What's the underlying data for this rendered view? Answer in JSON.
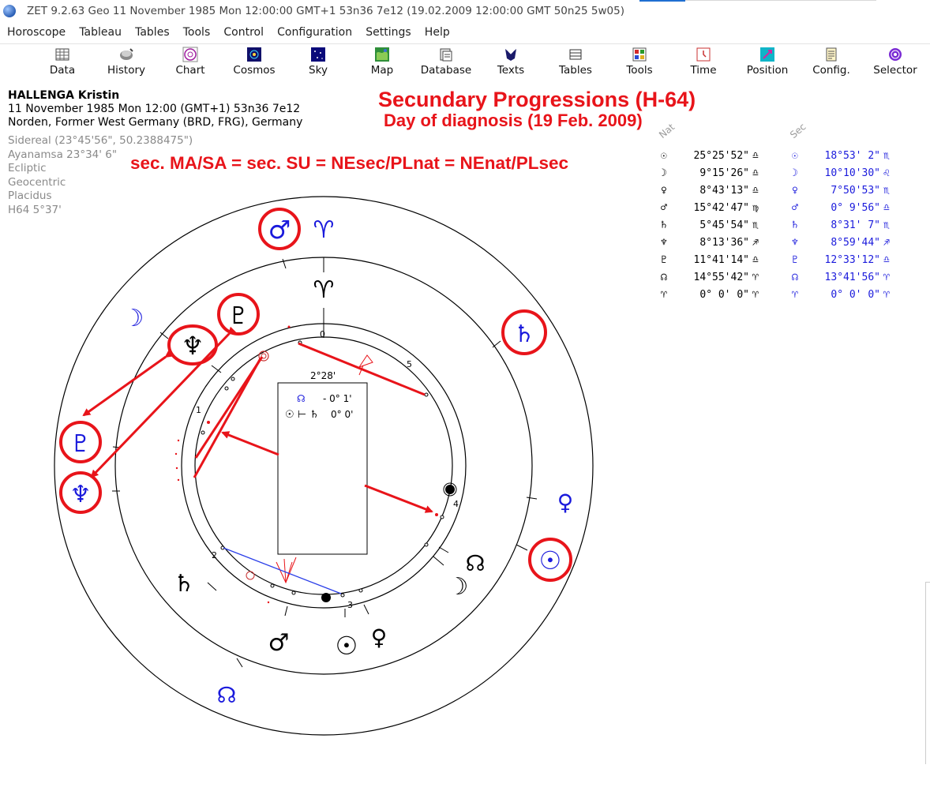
{
  "window": {
    "title": "ZET 9.2.63 Geo    11 November 1985  Mon  12:00:00 GMT+1 53n36  7e12  (19.02.2009  12:00:00 GMT 50n25 5w05)"
  },
  "menu": [
    "Horoscope",
    "Tableau",
    "Tables",
    "Tools",
    "Control",
    "Configuration",
    "Settings",
    "Help"
  ],
  "toolbar": [
    {
      "label": "Data",
      "icon": "data-icon"
    },
    {
      "label": "History",
      "icon": "history-icon"
    },
    {
      "label": "Chart",
      "icon": "chart-icon"
    },
    {
      "label": "Cosmos",
      "icon": "cosmos-icon"
    },
    {
      "label": "Sky",
      "icon": "sky-icon"
    },
    {
      "label": "Map",
      "icon": "map-icon"
    },
    {
      "label": "Database",
      "icon": "database-icon"
    },
    {
      "label": "Texts",
      "icon": "texts-icon"
    },
    {
      "label": "Tables",
      "icon": "tables-icon"
    },
    {
      "label": "Tools",
      "icon": "tools-icon"
    },
    {
      "label": "Time",
      "icon": "time-icon"
    },
    {
      "label": "Position",
      "icon": "position-icon"
    },
    {
      "label": "Config.",
      "icon": "config-icon"
    },
    {
      "label": "Selector",
      "icon": "selector-icon"
    }
  ],
  "info": {
    "name": "HALLENGA Kristin",
    "datetime": "11 November 1985  Mon  12:00 (GMT+1) 53n36  7e12",
    "place": "Norden, Former West Germany (BRD, FRG), Germany",
    "settings": [
      "Sidereal (23°45'56\", 50.2388475\")",
      "Ayanamsa 23°34' 6\"",
      "Ecliptic",
      "Geocentric",
      "Placidus",
      "H64   5°37'"
    ]
  },
  "annotations": {
    "title": "Secundary Progressions (H-64)",
    "subtitle": "Day of diagnosis (19 Feb. 2009)",
    "formula": "sec. MA/SA = sec. SU = NEsec/PLnat = NEnat/PLsec"
  },
  "table": {
    "header_nat": "Nat",
    "header_sec": "Sec",
    "rows": [
      {
        "glyph": "☉",
        "nat": "25°25'52\"",
        "nat_sign": "♎",
        "sec": "18°53' 2\"",
        "sec_sign": "♏"
      },
      {
        "glyph": "☽",
        "nat": "9°15'26\"",
        "nat_sign": "♎",
        "sec": "10°10'30\"",
        "sec_sign": "♌"
      },
      {
        "glyph": "♀",
        "nat": "8°43'13\"",
        "nat_sign": "♎",
        "sec": "7°50'53\"",
        "sec_sign": "♏"
      },
      {
        "glyph": "♂",
        "nat": "15°42'47\"",
        "nat_sign": "♍",
        "sec": "0° 9'56\"",
        "sec_sign": "♎"
      },
      {
        "glyph": "♄",
        "nat": "5°45'54\"",
        "nat_sign": "♏",
        "sec": "8°31' 7\"",
        "sec_sign": "♏"
      },
      {
        "glyph": "♆",
        "nat": "8°13'36\"",
        "nat_sign": "♐",
        "sec": "8°59'44\"",
        "sec_sign": "♐"
      },
      {
        "glyph": "♇",
        "nat": "11°41'14\"",
        "nat_sign": "♎",
        "sec": "12°33'12\"",
        "sec_sign": "♎"
      },
      {
        "glyph": "☊",
        "nat": "14°55'42\"",
        "nat_sign": "♈",
        "sec": "13°41'56\"",
        "sec_sign": "♈"
      },
      {
        "glyph": "♈",
        "nat": "0° 0' 0\"",
        "nat_sign": "♈",
        "sec": "0° 0' 0\"",
        "sec_sign": "♈"
      }
    ]
  },
  "chart": {
    "sec_glyphs": {
      "mars": "♂",
      "aries": "♈",
      "moon": "☽",
      "neptune": "♆",
      "pluto": "♇",
      "saturn": "♄",
      "venus": "♀",
      "sun": "☉",
      "node": "☊"
    },
    "nat_glyphs": {
      "aries": "♈",
      "pluto": "♇",
      "saturn": "♄",
      "mars": "♂",
      "sun": "☉",
      "venus": "♀",
      "moon": "☽",
      "node": "☊"
    },
    "house_numbers": [
      "0",
      "1",
      "2",
      "3",
      "4",
      "5"
    ],
    "box": {
      "arc": "2°28'",
      "node_row": "☊",
      "node_val": "- 0° 1'",
      "aspect_row": "☉ ⊢ ♄",
      "aspect_val": "0° 0'"
    },
    "colors": {
      "accent": "#e8141a",
      "sec_blue": "#1a1adc",
      "blue_line": "#2a3ee8"
    }
  }
}
